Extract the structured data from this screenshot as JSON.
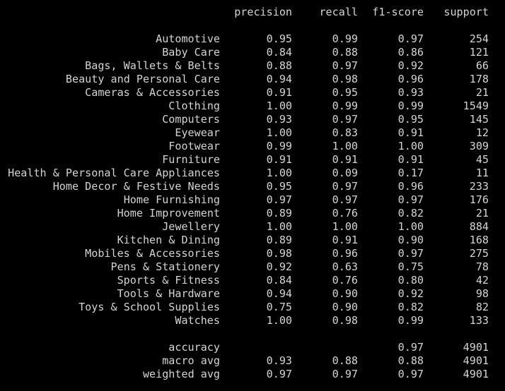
{
  "report": {
    "headers": {
      "precision": "precision",
      "recall": "recall",
      "f1": "f1-score",
      "support": "support"
    },
    "rows": [
      {
        "label": "Automotive",
        "precision": "0.95",
        "recall": "0.99",
        "f1": "0.97",
        "support": "254"
      },
      {
        "label": "Baby Care",
        "precision": "0.84",
        "recall": "0.88",
        "f1": "0.86",
        "support": "121"
      },
      {
        "label": "Bags, Wallets & Belts",
        "precision": "0.88",
        "recall": "0.97",
        "f1": "0.92",
        "support": "66"
      },
      {
        "label": "Beauty and Personal Care",
        "precision": "0.94",
        "recall": "0.98",
        "f1": "0.96",
        "support": "178"
      },
      {
        "label": "Cameras & Accessories",
        "precision": "0.91",
        "recall": "0.95",
        "f1": "0.93",
        "support": "21"
      },
      {
        "label": "Clothing",
        "precision": "1.00",
        "recall": "0.99",
        "f1": "0.99",
        "support": "1549"
      },
      {
        "label": "Computers",
        "precision": "0.93",
        "recall": "0.97",
        "f1": "0.95",
        "support": "145"
      },
      {
        "label": "Eyewear",
        "precision": "1.00",
        "recall": "0.83",
        "f1": "0.91",
        "support": "12"
      },
      {
        "label": "Footwear",
        "precision": "0.99",
        "recall": "1.00",
        "f1": "1.00",
        "support": "309"
      },
      {
        "label": "Furniture",
        "precision": "0.91",
        "recall": "0.91",
        "f1": "0.91",
        "support": "45"
      },
      {
        "label": "Health & Personal Care Appliances",
        "precision": "1.00",
        "recall": "0.09",
        "f1": "0.17",
        "support": "11"
      },
      {
        "label": "Home Decor & Festive Needs",
        "precision": "0.95",
        "recall": "0.97",
        "f1": "0.96",
        "support": "233"
      },
      {
        "label": "Home Furnishing",
        "precision": "0.97",
        "recall": "0.97",
        "f1": "0.97",
        "support": "176"
      },
      {
        "label": "Home Improvement",
        "precision": "0.89",
        "recall": "0.76",
        "f1": "0.82",
        "support": "21"
      },
      {
        "label": "Jewellery",
        "precision": "1.00",
        "recall": "1.00",
        "f1": "1.00",
        "support": "884"
      },
      {
        "label": "Kitchen & Dining",
        "precision": "0.89",
        "recall": "0.91",
        "f1": "0.90",
        "support": "168"
      },
      {
        "label": "Mobiles & Accessories",
        "precision": "0.98",
        "recall": "0.96",
        "f1": "0.97",
        "support": "275"
      },
      {
        "label": "Pens & Stationery",
        "precision": "0.92",
        "recall": "0.63",
        "f1": "0.75",
        "support": "78"
      },
      {
        "label": "Sports & Fitness",
        "precision": "0.84",
        "recall": "0.76",
        "f1": "0.80",
        "support": "42"
      },
      {
        "label": "Tools & Hardware",
        "precision": "0.94",
        "recall": "0.90",
        "f1": "0.92",
        "support": "98"
      },
      {
        "label": "Toys & School Supplies",
        "precision": "0.75",
        "recall": "0.90",
        "f1": "0.82",
        "support": "82"
      },
      {
        "label": "Watches",
        "precision": "1.00",
        "recall": "0.98",
        "f1": "0.99",
        "support": "133"
      }
    ],
    "summary": [
      {
        "label": "accuracy",
        "precision": "",
        "recall": "",
        "f1": "0.97",
        "support": "4901"
      },
      {
        "label": "macro avg",
        "precision": "0.93",
        "recall": "0.88",
        "f1": "0.88",
        "support": "4901"
      },
      {
        "label": "weighted avg",
        "precision": "0.97",
        "recall": "0.97",
        "f1": "0.97",
        "support": "4901"
      }
    ]
  }
}
